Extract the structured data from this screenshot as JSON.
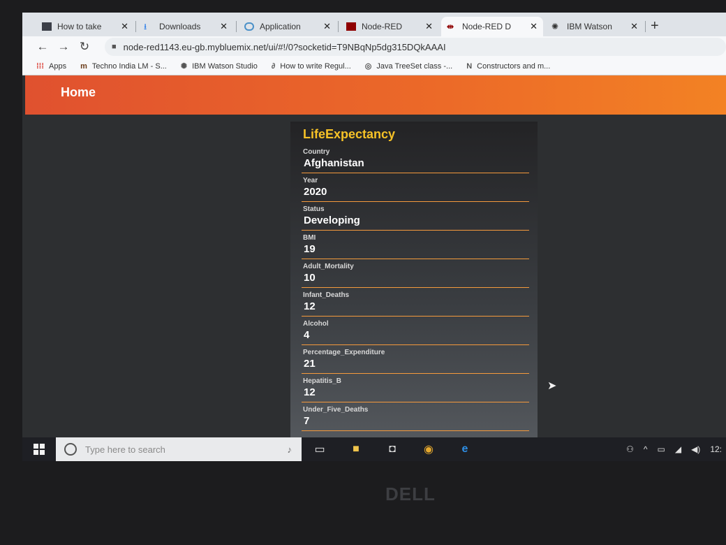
{
  "browser": {
    "tabs": [
      {
        "label": "How to take",
        "icon": "app-icon",
        "color": "#3b3f48"
      },
      {
        "label": "Downloads",
        "icon": "download-icon",
        "color": "#1a73e8"
      },
      {
        "label": "Application",
        "icon": "cloud-icon",
        "color": "#4a90c8"
      },
      {
        "label": "Node-RED",
        "icon": "node-red-icon",
        "color": "#8f0000"
      },
      {
        "label": "Node-RED D",
        "icon": "node-red-icon",
        "color": "#8f0000"
      },
      {
        "label": "IBM Watson",
        "icon": "watson-icon",
        "color": "#333333"
      }
    ],
    "url": "node-red1143.eu-gb.mybluemix.net/ui/#!/0?socketid=T9NBqNp5dg315DQkAAAI",
    "bookmarks": [
      {
        "label": "Apps",
        "icon": "apps-grid-icon"
      },
      {
        "label": "Techno India LM - S...",
        "icon": "tm-icon"
      },
      {
        "label": "IBM Watson Studio",
        "icon": "watson-icon"
      },
      {
        "label": "How to write Regul...",
        "icon": "dg-icon"
      },
      {
        "label": "Java TreeSet class -...",
        "icon": "edge-bookmark-icon"
      },
      {
        "label": "Constructors and m...",
        "icon": "n-icon"
      }
    ]
  },
  "page": {
    "header_title": "Home",
    "card_title": "LifeExpectancy",
    "fields": [
      {
        "label": "Country",
        "value": "Afghanistan"
      },
      {
        "label": "Year",
        "value": "2020"
      },
      {
        "label": "Status",
        "value": "Developing"
      },
      {
        "label": "BMI",
        "value": "19"
      },
      {
        "label": "Adult_Mortality",
        "value": "10"
      },
      {
        "label": "Infant_Deaths",
        "value": "12"
      },
      {
        "label": "Alcohol",
        "value": "4"
      },
      {
        "label": "Percentage_Expenditure",
        "value": "21"
      },
      {
        "label": "Hepatitis_B",
        "value": "12"
      },
      {
        "label": "Under_Five_Deaths",
        "value": "7"
      }
    ]
  },
  "taskbar": {
    "search_placeholder": "Type here to search",
    "clock": "12:"
  },
  "laptop_brand": "DELL",
  "colors": {
    "header_start": "#e0512f",
    "header_end": "#f38224",
    "card_title": "#f6c227",
    "field_underline": "#f59a3c"
  }
}
